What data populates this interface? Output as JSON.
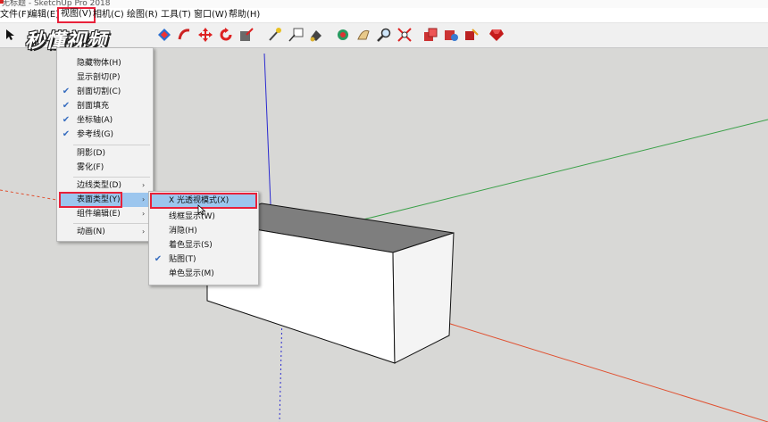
{
  "window": {
    "title": "无标题 - SketchUp Pro 2018"
  },
  "menubar": {
    "file": "文件(F)",
    "edit": "编辑(E)",
    "view": "视图(V)",
    "camera": "相机(C)",
    "draw": "绘图(R)",
    "tools": "工具(T)",
    "window": "窗口(W)",
    "help": "帮助(H)"
  },
  "toolbar_icons": [
    "select-icon",
    "orbit-icon",
    "pan-icon",
    "move-icon",
    "rotate-icon",
    "scale-icon",
    "tape-icon",
    "text-icon",
    "paint-icon",
    "section-icon",
    "walk-icon",
    "zoom-icon",
    "zoom-extents-icon",
    "components-icon",
    "warehouse-icon",
    "ruby-icon"
  ],
  "watermark": "秒懂视频",
  "view_menu": {
    "items": [
      {
        "label": "隐藏物体(H)",
        "checked": false,
        "submenu": false
      },
      {
        "label": "显示剖切(P)",
        "checked": false,
        "submenu": false
      },
      {
        "label": "剖面切割(C)",
        "checked": true,
        "submenu": false
      },
      {
        "label": "剖面填充",
        "checked": true,
        "submenu": false
      },
      {
        "label": "坐标轴(A)",
        "checked": true,
        "submenu": false
      },
      {
        "label": "参考线(G)",
        "checked": true,
        "submenu": false
      },
      {
        "label": "阴影(D)",
        "checked": false,
        "submenu": false
      },
      {
        "label": "雾化(F)",
        "checked": false,
        "submenu": false
      },
      {
        "label": "边线类型(D)",
        "checked": false,
        "submenu": true
      },
      {
        "label": "表面类型(Y)",
        "checked": false,
        "submenu": true
      },
      {
        "label": "组件编辑(E)",
        "checked": false,
        "submenu": true
      },
      {
        "label": "动画(N)",
        "checked": false,
        "submenu": true
      }
    ]
  },
  "face_style_submenu": {
    "items": [
      {
        "label": "X 光透视模式(X)",
        "checked": false
      },
      {
        "label": "线框显示(W)",
        "checked": false
      },
      {
        "label": "消隐(H)",
        "checked": false
      },
      {
        "label": "着色显示(S)",
        "checked": false
      },
      {
        "label": "贴图(T)",
        "checked": true
      },
      {
        "label": "单色显示(M)",
        "checked": false
      }
    ]
  },
  "colors": {
    "accent_highlight": "#e8213a",
    "menu_hover": "#9cc6ee",
    "check": "#3a6fc0",
    "axis_red": "#e05030",
    "axis_green": "#3aa048",
    "axis_blue": "#2a2ad0"
  }
}
